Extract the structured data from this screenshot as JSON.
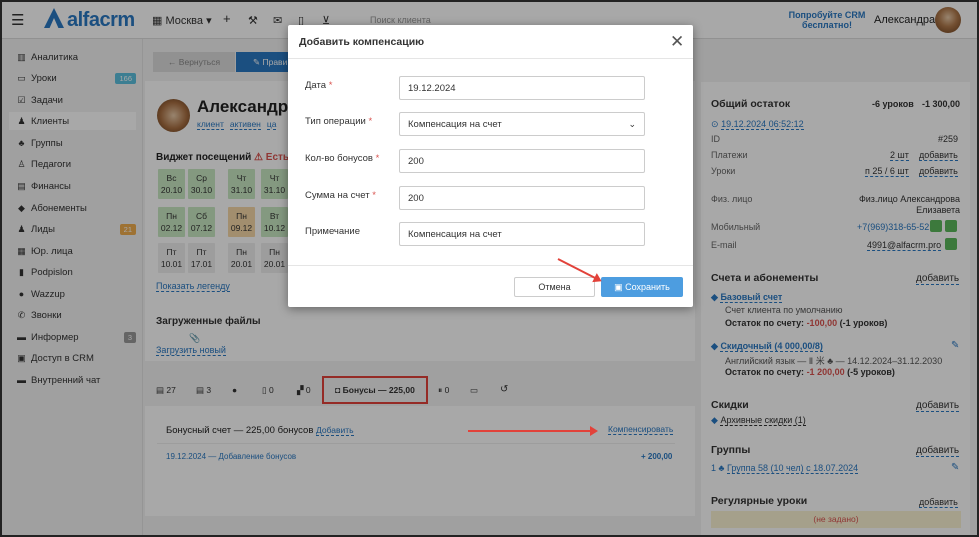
{
  "topbar": {
    "logo_text": "alfacrm",
    "branch": "Москва",
    "search_placeholder": "Поиск клиента",
    "try_text": "Попробуйте CRM бесплатно!",
    "user_name": "Александра"
  },
  "sidebar": {
    "items": [
      {
        "label": "Аналитика",
        "icon": "chart-icon"
      },
      {
        "label": "Уроки",
        "icon": "lessons-icon",
        "badge": "166"
      },
      {
        "label": "Задачи",
        "icon": "tasks-icon"
      },
      {
        "label": "Клиенты",
        "icon": "clients-icon"
      },
      {
        "label": "Группы",
        "icon": "groups-icon"
      },
      {
        "label": "Педагоги",
        "icon": "teachers-icon"
      },
      {
        "label": "Финансы",
        "icon": "finance-icon"
      },
      {
        "label": "Абонементы",
        "icon": "tag-icon"
      },
      {
        "label": "Лиды",
        "icon": "leads-icon",
        "badge": "21"
      },
      {
        "label": "Юр. лица",
        "icon": "legal-icon"
      },
      {
        "label": "Podpislon",
        "icon": "doc-icon"
      },
      {
        "label": "Wazzup",
        "icon": "whatsapp-icon"
      },
      {
        "label": "Звонки",
        "icon": "phone-icon"
      },
      {
        "label": "Информер",
        "icon": "informer-icon",
        "badge": "3"
      },
      {
        "label": "Доступ в CRM",
        "icon": "lock-icon"
      },
      {
        "label": "Внутренний чат",
        "icon": "chat-icon"
      }
    ]
  },
  "main": {
    "back_button": "← Вернуться",
    "edit_button": "✎ Прави",
    "client_name": "Александров",
    "tags": [
      "клиент",
      "активен",
      "ца"
    ],
    "widget_title": "Виджет посещений",
    "widget_warn": "⚠ Есть о",
    "cells_row1": [
      {
        "d": "Вс",
        "n": "20.10"
      },
      {
        "d": "Ср",
        "n": "30.10"
      },
      {
        "d": "Чт",
        "n": "31.10"
      },
      {
        "d": "Чт",
        "n": "31.10"
      }
    ],
    "cells_row2": [
      {
        "d": "Пн",
        "n": "02.12"
      },
      {
        "d": "Сб",
        "n": "07.12"
      },
      {
        "d": "Пн",
        "n": "09.12"
      },
      {
        "d": "Вт",
        "n": "10.12"
      }
    ],
    "cells_row3": [
      {
        "d": "Пт",
        "n": "10.01"
      },
      {
        "d": "Пт",
        "n": "17.01"
      },
      {
        "d": "Пн",
        "n": "20.01"
      },
      {
        "d": "Пн",
        "n": "20.01"
      }
    ],
    "legend_link": "Показать легенду",
    "files_title": "Загруженные файлы",
    "upload_link": "Загрузить новый",
    "tabs": [
      "27",
      "3",
      "",
      "0",
      "0",
      "Бонусы — 225,00",
      "0",
      "",
      ""
    ],
    "bonus_account": "Бонусный счет — 225,00 бонусов",
    "add_link": "Добавить",
    "compensate_link": "Компенсировать",
    "bonus_row_text": "19.12.2024 — Добавление бонусов",
    "bonus_row_amount": "+ 200,00"
  },
  "right": {
    "balance_title": "Общий остаток",
    "balance_lessons": "-6 уроков",
    "balance_money": "-1 300,00",
    "balance_date": "19.12.2024 06:52:12",
    "id_label": "ID",
    "id_value": "#259",
    "payments_label": "Платежи",
    "payments_value": "2 шт",
    "payments_add": "добавить",
    "lessons_label": "Уроки",
    "lessons_value": "п 25 / 6 шт",
    "lessons_add": "добавить",
    "person_label": "Физ. лицо",
    "person_value": "Физ.лицо Александрова Елизавета",
    "mobile_label": "Мобильный",
    "mobile_value": "+7(969)318-65-52",
    "email_label": "E-mail",
    "email_value": "4991@alfacrm.pro",
    "accounts_title": "Счета и абонементы",
    "accounts_add": "добавить",
    "base_account": "Базовый счет",
    "base_desc": "Счет клиента по умолчанию",
    "base_balance_label": "Остаток по счету:",
    "base_balance_value": "-100,00",
    "base_balance_lessons": "(-1 уроков)",
    "discount_account": "Скидочный (4 000,00/8)",
    "discount_desc": "Английский язык — Ⅱ 米 ♣ — 14.12.2024–31.12.2030",
    "discount_balance_label": "Остаток по счету:",
    "discount_balance_value": "-1 200,00",
    "discount_balance_lessons": "(-5 уроков)",
    "discounts_title": "Скидки",
    "discounts_add": "добавить",
    "archive_discounts": "Архивные скидки (1)",
    "groups_title": "Группы",
    "groups_add": "добавить",
    "group_item": "Группа 58 (10 чел) с 18.07.2024",
    "group_prefix": "1",
    "regular_title": "Регулярные уроки",
    "regular_add": "добавить",
    "regular_empty": "(не задано)"
  },
  "modal": {
    "title": "Добавить компенсацию",
    "fields": [
      {
        "label": "Дата",
        "required": true,
        "value": "19.12.2024"
      },
      {
        "label": "Тип операции",
        "required": true,
        "value": "Компенсация на счет"
      },
      {
        "label": "Кол-во бонусов",
        "required": true,
        "value": "200"
      },
      {
        "label": "Сумма на счет",
        "required": true,
        "value": "200"
      },
      {
        "label": "Примечание",
        "required": false,
        "value": "Компенсация на счет"
      }
    ],
    "cancel": "Отмена",
    "save": "Сохранить"
  },
  "colors": {
    "accent": "#2a78c2",
    "save": "#4d9de0",
    "danger": "#d9534f",
    "annotation": "#e2423a"
  }
}
